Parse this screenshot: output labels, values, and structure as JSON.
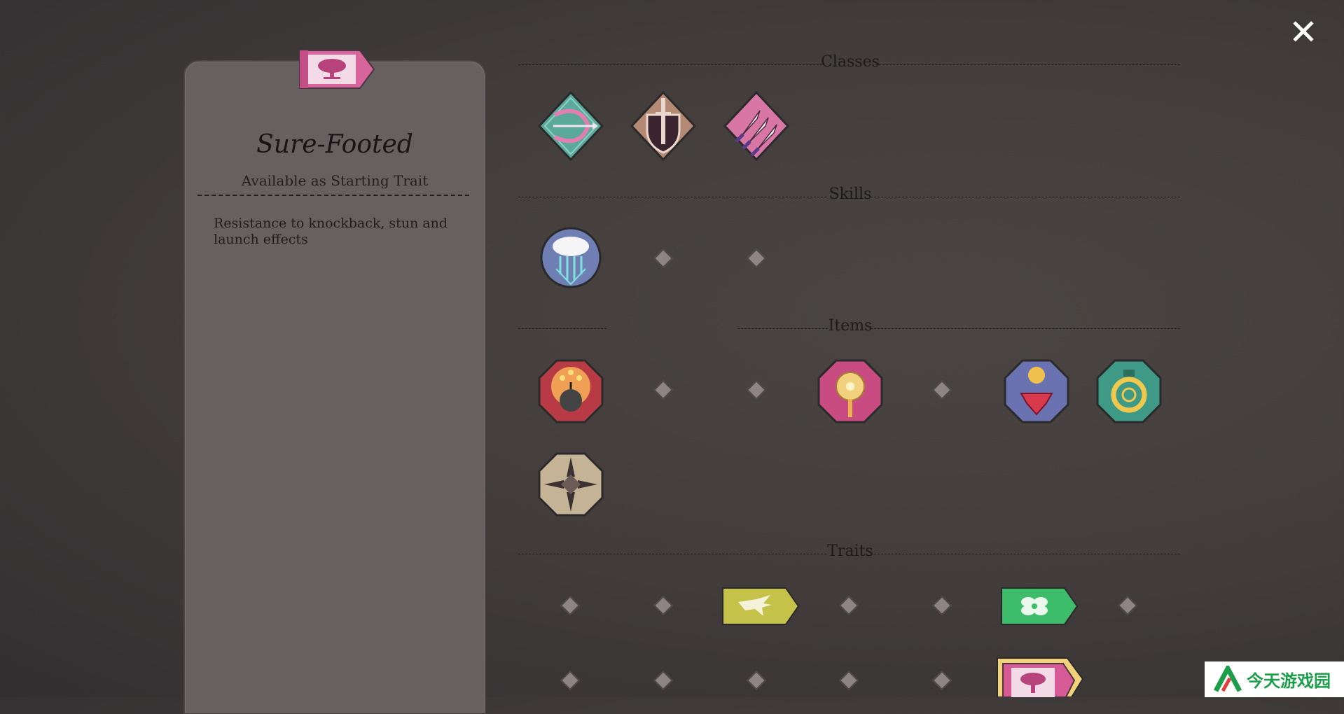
{
  "close": {
    "icon": "close-icon",
    "glyph": "✕"
  },
  "panel": {
    "badge_icon": "tree-icon",
    "title": "Sure-Footed",
    "subtitle": "Available as Starting Trait",
    "description": "Resistance to knockback, stun and launch effects"
  },
  "sections": {
    "classes": "Classes",
    "skills": "Skills",
    "items": "Items",
    "traits": "Traits"
  },
  "classes": [
    {
      "icon": "bow-icon",
      "color": "#5aa99a"
    },
    {
      "icon": "sword-shield-icon",
      "color": "#b48a74"
    },
    {
      "icon": "throwing-knives-icon",
      "color": "#d877a6"
    }
  ],
  "skills": [
    {
      "icon": "rain-cloud-icon",
      "color": "#6f7fb4"
    }
  ],
  "items": [
    {
      "icon": "bomb-icon",
      "color": "#b83a44"
    },
    {
      "icon": "mace-icon",
      "color": "#c84c82"
    },
    {
      "icon": "gem-icon",
      "color": "#6a72b2"
    },
    {
      "icon": "ring-icon",
      "color": "#3e9a86"
    },
    {
      "icon": "crossed-blades-icon",
      "color": "#c4b394"
    }
  ],
  "traits": [
    {
      "icon": "eagle-icon",
      "color": "#c5c24a"
    },
    {
      "icon": "clover-icon",
      "color": "#3dbd6a"
    },
    {
      "icon": "tree-icon",
      "color": "#d65a95",
      "selected": true
    }
  ],
  "watermark": {
    "text": "今天游戏园"
  }
}
